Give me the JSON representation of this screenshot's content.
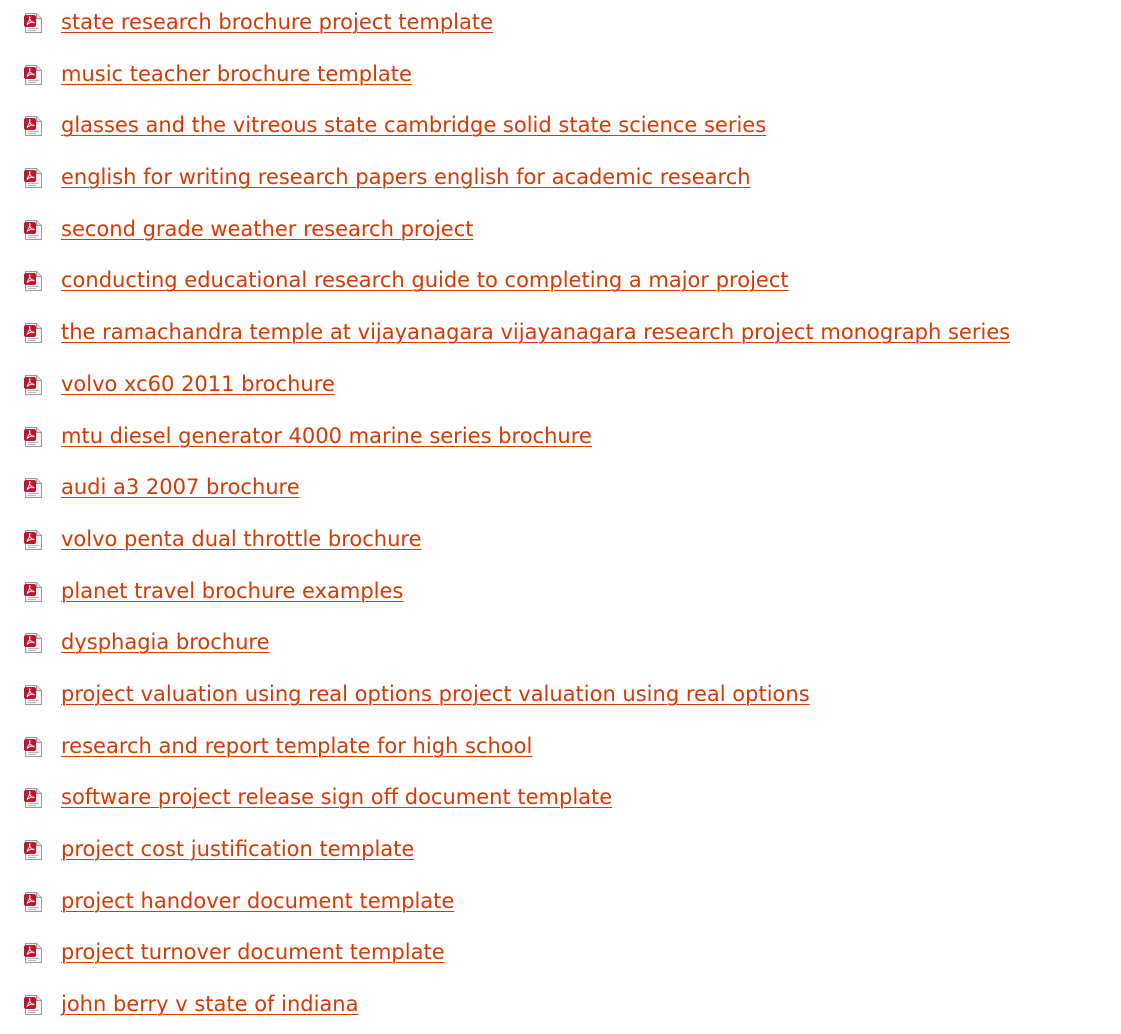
{
  "links": [
    {
      "label": "state research brochure project template",
      "icon": "pdf-file-icon"
    },
    {
      "label": "music teacher brochure template",
      "icon": "pdf-file-icon"
    },
    {
      "label": "glasses and the vitreous state cambridge solid state science series",
      "icon": "pdf-file-icon"
    },
    {
      "label": "english for writing research papers english for academic research",
      "icon": "pdf-file-icon"
    },
    {
      "label": "second grade weather research project",
      "icon": "pdf-file-icon"
    },
    {
      "label": "conducting educational research guide to completing a major project",
      "icon": "pdf-file-icon"
    },
    {
      "label": "the ramachandra temple at vijayanagara vijayanagara research project monograph series",
      "icon": "pdf-file-icon"
    },
    {
      "label": "volvo xc60 2011 brochure",
      "icon": "pdf-file-icon"
    },
    {
      "label": "mtu diesel generator 4000 marine series brochure",
      "icon": "pdf-file-icon"
    },
    {
      "label": "audi a3 2007 brochure",
      "icon": "pdf-file-icon"
    },
    {
      "label": "volvo penta dual throttle brochure",
      "icon": "pdf-file-icon"
    },
    {
      "label": "planet travel brochure examples",
      "icon": "pdf-file-icon"
    },
    {
      "label": "dysphagia brochure",
      "icon": "pdf-file-icon"
    },
    {
      "label": "project valuation using real options project valuation using real options",
      "icon": "pdf-file-icon"
    },
    {
      "label": "research and report template for high school",
      "icon": "pdf-file-icon"
    },
    {
      "label": "software project release sign off document template",
      "icon": "pdf-file-icon"
    },
    {
      "label": "project cost justification template",
      "icon": "pdf-file-icon"
    },
    {
      "label": "project handover document template",
      "icon": "pdf-file-icon"
    },
    {
      "label": "project turnover document template",
      "icon": "pdf-file-icon"
    },
    {
      "label": "john berry v state of indiana",
      "icon": "pdf-file-icon"
    }
  ],
  "colors": {
    "link": "#d13b06",
    "icon_red": "#c8102e",
    "background": "#ffffff"
  }
}
